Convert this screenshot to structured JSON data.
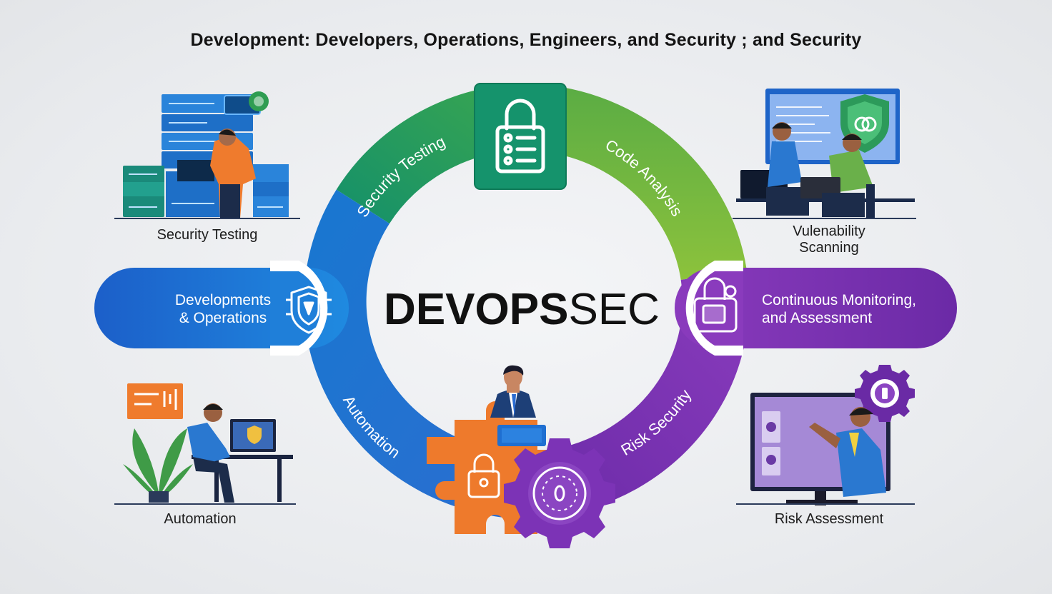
{
  "title": "Development: Developers, Operations, Engineers, and Security ; and Security",
  "center": {
    "bold": "DEVOPS",
    "light": "SEC"
  },
  "ring_labels": {
    "security_testing": "Security Testing",
    "code_analysis": "Code Analysis",
    "automation": "Automation",
    "risk_security": "Risk Security"
  },
  "pills": {
    "left_line1": "Developments",
    "left_line2": "& Operations",
    "right_line1": "Continuous Monitoring,",
    "right_line2": "and Assessment"
  },
  "captions": {
    "top_left": "Security Testing",
    "top_right_line1": "Vulenability",
    "top_right_line2": "Scanning",
    "bottom_left": "Automation",
    "bottom_right": "Risk Assessment"
  },
  "colors": {
    "teal": "#168f6c",
    "green": "#3fa84d",
    "lime": "#79b83f",
    "blue": "#1f72d1",
    "purple": "#7b34b5",
    "orange": "#ee7a2c"
  }
}
